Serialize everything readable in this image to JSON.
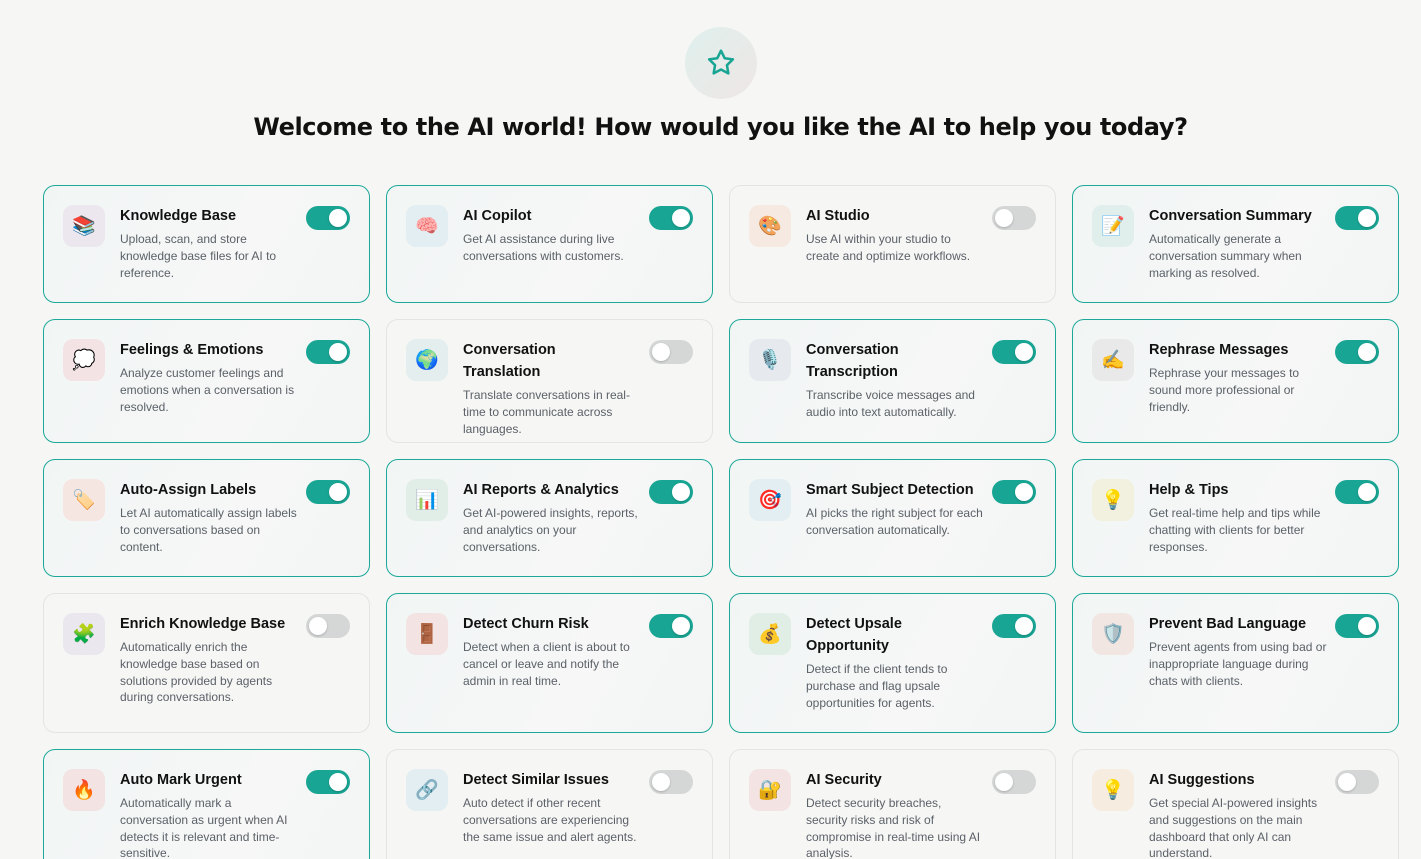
{
  "header": {
    "star_icon": "star-outline-icon",
    "title": "Welcome to the AI world! How would you like the AI to help you today?"
  },
  "colors": {
    "accent": "#19a594",
    "toggle_off": "#d5d6d6"
  },
  "features": [
    {
      "title": "Knowledge Base",
      "desc": "Upload, scan, and store knowledge base files for AI to reference.",
      "icon": "books-icon",
      "emoji": "📚",
      "tint": "#ece7ef",
      "enabled": true
    },
    {
      "title": "AI Copilot",
      "desc": "Get AI assistance during live conversations with customers.",
      "icon": "brain-icon",
      "emoji": "🧠",
      "tint": "#e3eef2",
      "enabled": true
    },
    {
      "title": "AI Studio",
      "desc": "Use AI within your studio to create and optimize workflows.",
      "icon": "palette-icon",
      "emoji": "🎨",
      "tint": "#f6e9e1",
      "enabled": false
    },
    {
      "title": "Conversation Summary",
      "desc": "Automatically generate a conversation summary when marking as resolved.",
      "icon": "memo-icon",
      "emoji": "📝",
      "tint": "#e1efec",
      "enabled": true
    },
    {
      "title": "Feelings & Emotions",
      "desc": "Analyze customer feelings and emotions when a conversation is resolved.",
      "icon": "thought-bubble-icon",
      "emoji": "💭",
      "tint": "#f3e3e5",
      "enabled": true
    },
    {
      "title": "Conversation Translation",
      "desc": "Translate conversations in real-time to communicate across languages.",
      "icon": "globe-icon",
      "emoji": "🌍",
      "tint": "#e4eeee",
      "enabled": false
    },
    {
      "title": "Conversation Transcription",
      "desc": "Transcribe voice messages and audio into text automatically.",
      "icon": "microphone-icon",
      "emoji": "🎙️",
      "tint": "#e6eaee",
      "enabled": true
    },
    {
      "title": "Rephrase Messages",
      "desc": "Rephrase your messages to sound more professional or friendly.",
      "icon": "writing-hand-icon",
      "emoji": "✍️",
      "tint": "#e8e9e8",
      "enabled": true
    },
    {
      "title": "Auto-Assign Labels",
      "desc": "Let AI automatically assign labels to conversations based on content.",
      "icon": "label-tag-icon",
      "emoji": "🏷️",
      "tint": "#f6e6e1",
      "enabled": true
    },
    {
      "title": "AI Reports & Analytics",
      "desc": "Get AI-powered insights, reports, and analytics on your conversations.",
      "icon": "bar-chart-icon",
      "emoji": "📊",
      "tint": "#e1eee8",
      "enabled": true
    },
    {
      "title": "Smart Subject Detection",
      "desc": "AI picks the right subject for each conversation automatically.",
      "icon": "target-icon",
      "emoji": "🎯",
      "tint": "#e3eef2",
      "enabled": true
    },
    {
      "title": "Help & Tips",
      "desc": "Get real-time help and tips while chatting with clients for better responses.",
      "icon": "lightbulb-icon",
      "emoji": "💡",
      "tint": "#f2f1df",
      "enabled": true
    },
    {
      "title": "Enrich Knowledge Base",
      "desc": "Automatically enrich the knowledge base based on solutions provided by agents during conversations.",
      "icon": "puzzle-piece-icon",
      "emoji": "🧩",
      "tint": "#ebe7ef",
      "enabled": false
    },
    {
      "title": "Detect Churn Risk",
      "desc": "Detect when a client is about to cancel or leave and notify the admin in real time.",
      "icon": "door-icon",
      "emoji": "🚪",
      "tint": "#f3e3e3",
      "enabled": true
    },
    {
      "title": "Detect Upsale Opportunity",
      "desc": "Detect if the client tends to purchase and flag upsale opportunities for agents.",
      "icon": "money-bag-icon",
      "emoji": "💰",
      "tint": "#e1eee6",
      "enabled": true
    },
    {
      "title": "Prevent Bad Language",
      "desc": "Prevent agents from using bad or inappropriate language during chats with clients.",
      "icon": "shield-icon",
      "emoji": "🛡️",
      "tint": "#f2e6e3",
      "enabled": true
    },
    {
      "title": "Auto Mark Urgent",
      "desc": "Automatically mark a conversation as urgent when AI detects it is relevant and time-sensitive.",
      "icon": "fire-icon",
      "emoji": "🔥",
      "tint": "#f3e3e3",
      "enabled": true
    },
    {
      "title": "Detect Similar Issues",
      "desc": "Auto detect if other recent conversations are experiencing the same issue and alert agents.",
      "icon": "link-icon",
      "emoji": "🔗",
      "tint": "#e3eef2",
      "enabled": false
    },
    {
      "title": "AI Security",
      "desc": "Detect security breaches, security risks and risk of compromise in real-time using AI analysis.",
      "icon": "lock-icon",
      "emoji": "🔐",
      "tint": "#f3e3e3",
      "enabled": false
    },
    {
      "title": "AI Suggestions",
      "desc": "Get special AI-powered insights and suggestions on the main dashboard that only AI can understand.",
      "icon": "lightbulb-icon",
      "emoji": "💡",
      "tint": "#f6ece0",
      "enabled": false
    }
  ]
}
